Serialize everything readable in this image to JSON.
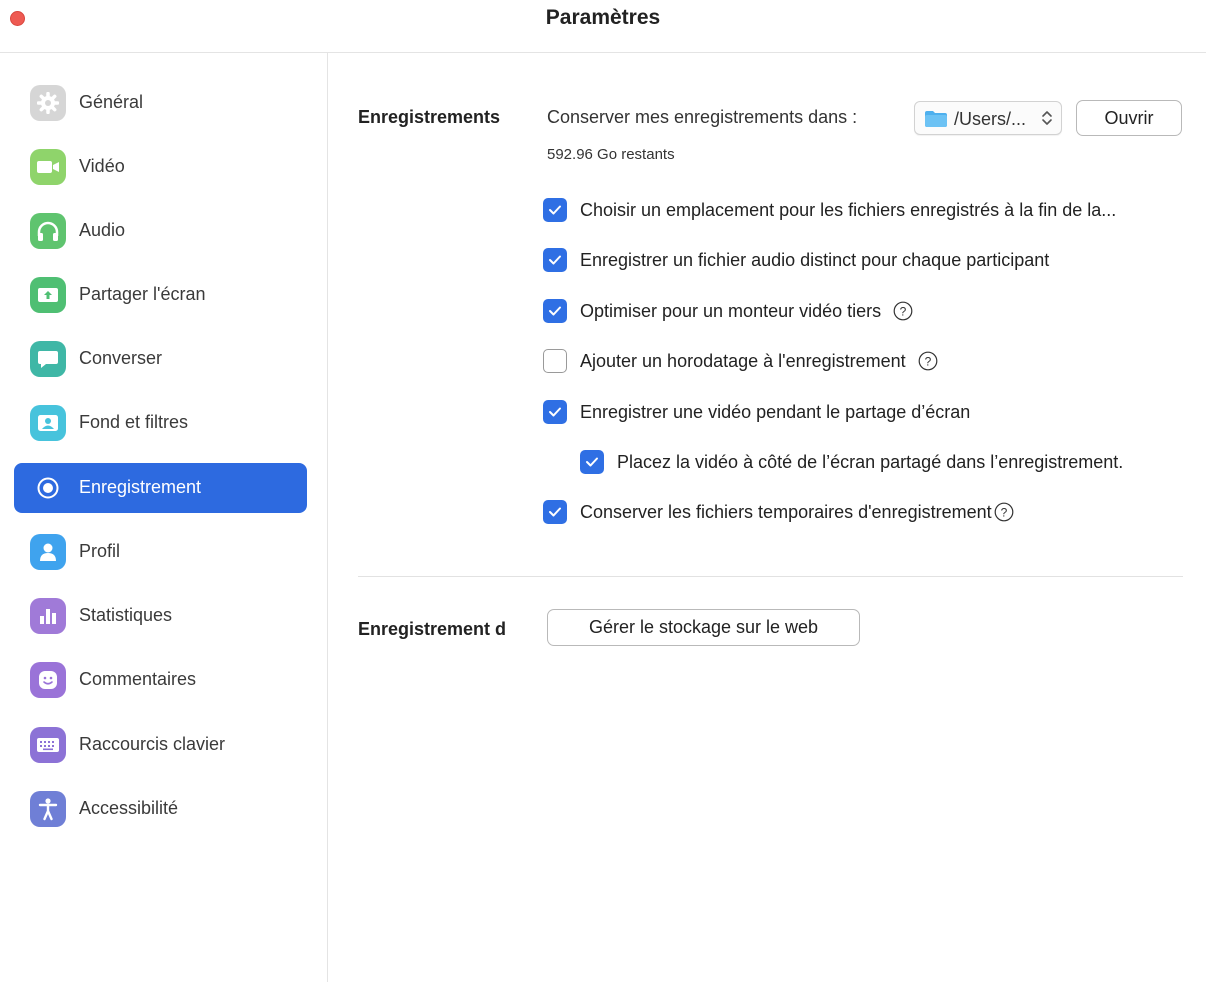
{
  "window": {
    "title": "Paramètres"
  },
  "sidebar": {
    "items": [
      {
        "label": "Général",
        "icon": "gear-icon",
        "color": "#d6d6d6",
        "active": false
      },
      {
        "label": "Vidéo",
        "icon": "video-camera-icon",
        "color": "#8fd46b",
        "active": false
      },
      {
        "label": "Audio",
        "icon": "headphones-icon",
        "color": "#5fc46f",
        "active": false
      },
      {
        "label": "Partager l'écran",
        "icon": "share-screen-icon",
        "color": "#4fbf73",
        "active": false
      },
      {
        "label": "Converser",
        "icon": "chat-bubble-icon",
        "color": "#3fb7a6",
        "active": false
      },
      {
        "label": "Fond et filtres",
        "icon": "background-person-icon",
        "color": "#47c3dc",
        "active": false
      },
      {
        "label": "Enregistrement",
        "icon": "record-icon",
        "color": "#2d6ae0",
        "active": true
      },
      {
        "label": "Profil",
        "icon": "person-icon",
        "color": "#3fa3ee",
        "active": false
      },
      {
        "label": "Statistiques",
        "icon": "bar-chart-icon",
        "color": "#a07ad8",
        "active": false
      },
      {
        "label": "Commentaires",
        "icon": "smiley-icon",
        "color": "#9a73d8",
        "active": false
      },
      {
        "label": "Raccourcis clavier",
        "icon": "keyboard-icon",
        "color": "#8c72d6",
        "active": false
      },
      {
        "label": "Accessibilité",
        "icon": "accessibility-icon",
        "color": "#6f7fd6",
        "active": false
      }
    ]
  },
  "local_recording": {
    "section_label": "Enregistrements",
    "location_label": "Conserver mes enregistrements dans :",
    "folder_value": "/Users/...",
    "open_button": "Ouvrir",
    "free_space": "592.96 Go restants",
    "options": [
      {
        "label": "Choisir un emplacement pour les fichiers enregistrés à la fin de la...",
        "checked": true,
        "help": false,
        "indent": false
      },
      {
        "label": "Enregistrer un fichier audio distinct pour chaque participant",
        "checked": true,
        "help": false,
        "indent": false
      },
      {
        "label": "Optimiser pour un monteur vidéo tiers",
        "checked": true,
        "help": true,
        "indent": false
      },
      {
        "label": "Ajouter un horodatage à l'enregistrement",
        "checked": false,
        "help": true,
        "indent": false
      },
      {
        "label": "Enregistrer une vidéo pendant le partage d’écran",
        "checked": true,
        "help": false,
        "indent": false
      },
      {
        "label": "Placez la vidéo à côté de l’écran partagé dans l’enregistrement.",
        "checked": true,
        "help": false,
        "indent": true
      },
      {
        "label": "Conserver les fichiers temporaires d'enregistrement",
        "checked": true,
        "help": true,
        "indent": false
      }
    ]
  },
  "cloud_recording": {
    "section_label": "Enregistrement d",
    "manage_button": "Gérer le stockage sur le web"
  },
  "colors": {
    "accent": "#2d6ae0",
    "checkbox_on": "#2f6fe4",
    "close_button": "#ee5a52"
  }
}
